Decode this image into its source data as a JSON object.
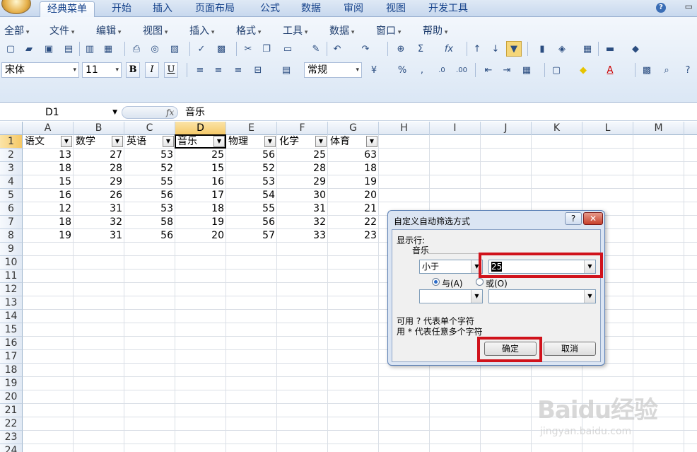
{
  "tabs": [
    "经典菜单",
    "开始",
    "插入",
    "页面布局",
    "公式",
    "数据",
    "审阅",
    "视图",
    "开发工具"
  ],
  "menus": [
    "全部",
    "文件",
    "编辑",
    "视图",
    "插入",
    "格式",
    "工具",
    "数据",
    "窗口",
    "帮助"
  ],
  "toolbar": {
    "font_name": "宋体",
    "font_size": "11",
    "bold": "B",
    "italic": "I",
    "underline": "U",
    "number_format": "常规",
    "percent": "%",
    "comma": ",",
    "sum": "Σ",
    "fx": "fx"
  },
  "formula_bar": {
    "name_box": "D1",
    "value": "音乐"
  },
  "columns": [
    "A",
    "B",
    "C",
    "D",
    "E",
    "F",
    "G",
    "H",
    "I",
    "J",
    "K",
    "L",
    "M"
  ],
  "rows": [
    "1",
    "2",
    "3",
    "4",
    "5",
    "6",
    "7",
    "8",
    "9",
    "10",
    "11",
    "12",
    "13",
    "14",
    "15",
    "16",
    "17",
    "18",
    "19",
    "20",
    "21",
    "22",
    "23",
    "24"
  ],
  "headers": [
    "语文",
    "数学",
    "英语",
    "音乐",
    "物理",
    "化学",
    "体育"
  ],
  "data": [
    [
      "13",
      "27",
      "53",
      "25",
      "56",
      "25",
      "63"
    ],
    [
      "18",
      "28",
      "52",
      "15",
      "52",
      "28",
      "18"
    ],
    [
      "15",
      "29",
      "55",
      "16",
      "53",
      "29",
      "19"
    ],
    [
      "16",
      "26",
      "56",
      "17",
      "54",
      "30",
      "20"
    ],
    [
      "12",
      "31",
      "53",
      "18",
      "55",
      "31",
      "21"
    ],
    [
      "18",
      "32",
      "58",
      "19",
      "56",
      "32",
      "22"
    ],
    [
      "19",
      "31",
      "56",
      "20",
      "57",
      "33",
      "23"
    ]
  ],
  "dialog": {
    "title": "自定义自动筛选方式",
    "help": "?",
    "close": "✕",
    "show_rows": "显示行:",
    "field": "音乐",
    "operator1": "小于",
    "value1": "25",
    "and_label": "与(A)",
    "or_label": "或(O)",
    "operator2": "",
    "value2": "",
    "hint1": "可用 ? 代表单个字符",
    "hint2": "用 * 代表任意多个字符",
    "ok": "确定",
    "cancel": "取消"
  },
  "watermark": {
    "logo": "Baidu经验",
    "sub": "jingyan.baidu.com"
  },
  "colors": {
    "highlight": "#d0121b",
    "selected_header": "#f5c865"
  }
}
